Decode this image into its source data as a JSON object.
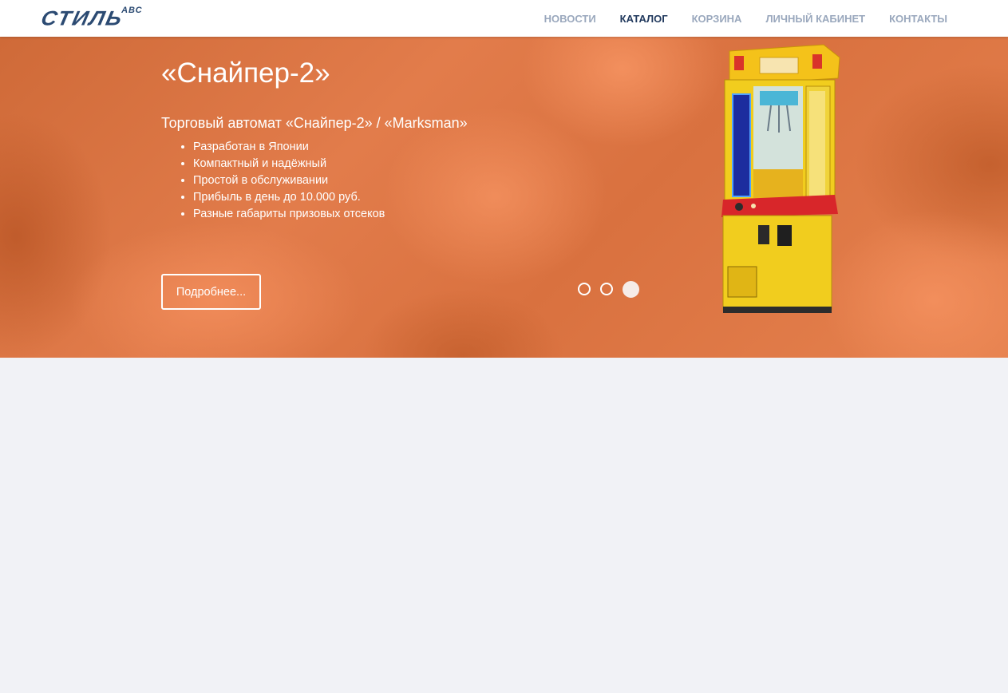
{
  "header": {
    "logo_text": "СТИЛЬ",
    "logo_sup": "АВС",
    "nav": [
      {
        "label": "НОВОСТИ",
        "active": false
      },
      {
        "label": "КАТАЛОГ",
        "active": true
      },
      {
        "label": "КОРЗИНА",
        "active": false
      },
      {
        "label": "ЛИЧНЫЙ КАБИНЕТ",
        "active": false
      },
      {
        "label": "КОНТАКТЫ",
        "active": false
      }
    ]
  },
  "slider": {
    "title": "«Снайпер-2»",
    "subtitle": "Торговый автомат «Снайпер-2» / «Marksman»",
    "features": [
      "Разработан в Японии",
      "Компактный и надёжный",
      "Простой в обслуживании",
      "Прибыль в день до 10.000 руб.",
      "Разные габариты призовых отсеков"
    ],
    "button_label": "Подробнее...",
    "slide_count": 3,
    "active_slide": 3,
    "image_name": "claw-machine-image",
    "colors": {
      "accent": "#e27c4b",
      "machine": "#f3d21c"
    }
  }
}
